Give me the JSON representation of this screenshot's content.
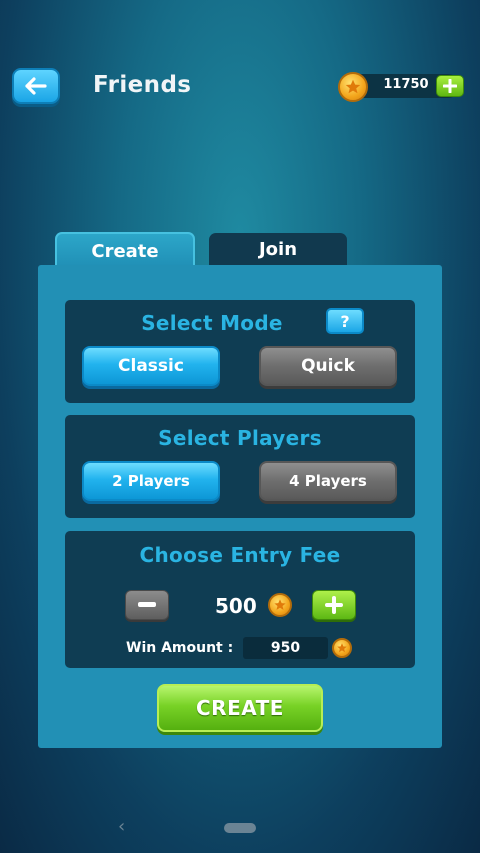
{
  "header": {
    "title": "Friends",
    "coins": "11750",
    "back_icon": "arrow-left-icon",
    "coin_icon": "star-coin-icon",
    "add_icon": "plus-icon"
  },
  "tabs": [
    {
      "label": "Create",
      "active": true
    },
    {
      "label": "Join",
      "active": false
    }
  ],
  "mode": {
    "title": "Select Mode",
    "help": "?",
    "options": [
      {
        "label": "Classic",
        "selected": true
      },
      {
        "label": "Quick",
        "selected": false
      }
    ]
  },
  "players": {
    "title": "Select Players",
    "options": [
      {
        "label": "2 Players",
        "selected": true
      },
      {
        "label": "4 Players",
        "selected": false
      }
    ]
  },
  "entry_fee": {
    "title": "Choose Entry Fee",
    "value": "500",
    "win_label": "Win Amount :",
    "win_value": "950"
  },
  "create_label": "CREATE",
  "colors": {
    "accent_blue": "#22b3ee",
    "accent_green": "#78d226",
    "section_title": "#2ab4e2",
    "panel": "#2290b5"
  }
}
